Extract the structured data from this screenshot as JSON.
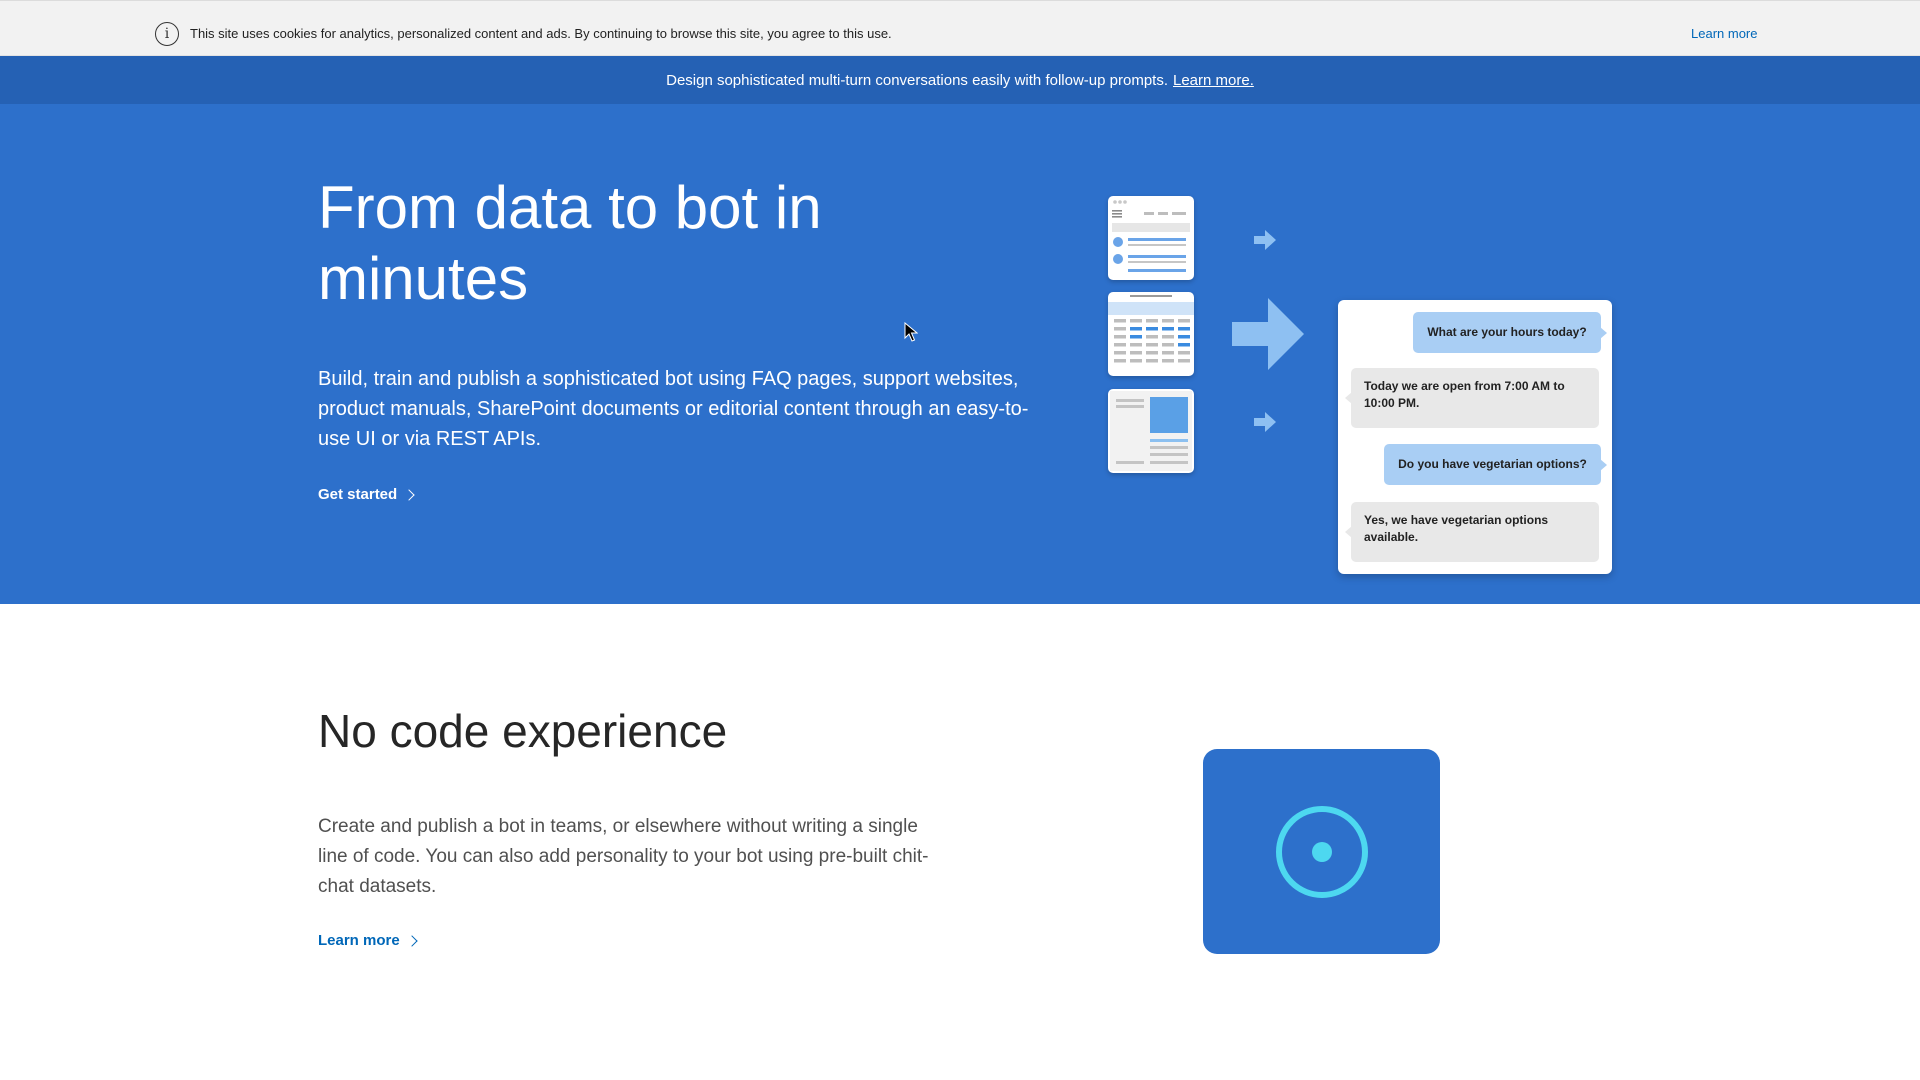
{
  "cookie_banner": {
    "icon": "info-icon",
    "icon_glyph": "i",
    "text": "This site uses cookies for analytics, personalized content and ads. By continuing to browse this site, you agree to this use.",
    "learn_more": "Learn more"
  },
  "promo_banner": {
    "text": "Design sophisticated multi-turn conversations easily with follow-up prompts.",
    "link": "Learn more."
  },
  "hero": {
    "title": "From data to bot in minutes",
    "description": "Build, train and publish a sophisticated bot using FAQ pages, support websites, product manuals, SharePoint documents or editorial content through an easy-to-use UI or via REST APIs.",
    "cta": "Get started",
    "chat": [
      {
        "from": "user",
        "text": "What are your hours today?"
      },
      {
        "from": "bot",
        "text": "Today we are open from 7:00 AM to 10:00 PM."
      },
      {
        "from": "user",
        "text": "Do you have vegetarian options?"
      },
      {
        "from": "bot",
        "text": "Yes, we have vegetarian options available."
      }
    ]
  },
  "feature": {
    "title": "No code experience",
    "description": "Create and publish a bot in teams, or elsewhere without writing a single line of code. You can also add personality to your bot using pre-built chit-chat datasets.",
    "cta": "Learn more",
    "icon": "target-circle-icon"
  },
  "colors": {
    "hero_bg": "#2d70cb",
    "promo_bg": "#2561b4",
    "cookie_bg": "#f2f2f2",
    "link": "#0067b8",
    "user_bubble": "#a9cef4",
    "bot_bubble": "#e8e8e8",
    "accent_cyan": "#4dd8f0"
  }
}
